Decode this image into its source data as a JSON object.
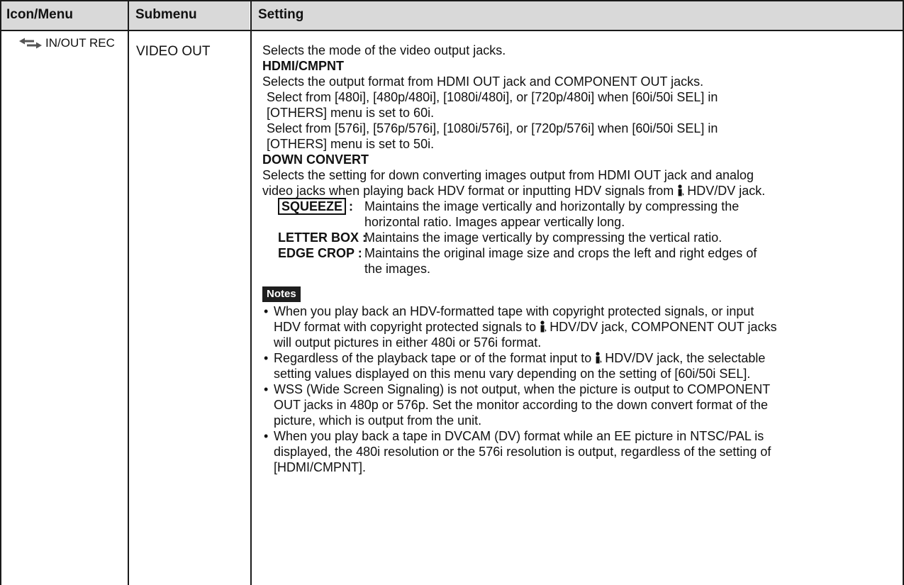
{
  "header": {
    "col1": "Icon/Menu",
    "col2": "Submenu",
    "col3": "Setting"
  },
  "row": {
    "menu": "IN/OUT REC",
    "submenu": "VIDEO OUT",
    "menu_icon": "in-out-arrows-icon"
  },
  "setting": {
    "intro": "Selects the mode of the video output jacks.",
    "hdmi_heading": "HDMI/CMPNT",
    "hdmi_desc": "Selects the output format from HDMI OUT jack and COMPONENT OUT jacks.",
    "select60_a": "Select from [480i], [480p/480i], [1080i/480i], or [720p/480i] when [60i/50i SEL] in",
    "select60_b": "[OTHERS] menu is set to 60i.",
    "select50_a": "Select from [576i], [576p/576i], [1080i/576i], or [720p/576i] when [60i/50i SEL] in",
    "select50_b": "[OTHERS] menu is set to 50i.",
    "down_heading": "DOWN CONVERT",
    "down_desc_a": "Selects the setting for down converting images output from HDMI OUT jack and analog",
    "down_desc_b_pre": "video jacks when playing back HDV format or inputting HDV signals from",
    "down_desc_b_post": "HDV/DV jack.",
    "options": [
      {
        "term": "SQUEEZE",
        "sep": ":",
        "desc": "Maintains the image vertically and horizontally by compressing the horizontal ratio. Images appear vertically long."
      },
      {
        "term": "LETTER BOX :",
        "desc": "Maintains the image vertically by compressing the vertical ratio."
      },
      {
        "term": "EDGE CROP :",
        "desc": "Maintains the original image size and crops the left and right edges of the images."
      }
    ],
    "notes_label": "Notes",
    "notes": {
      "n1_a": "When you play back an HDV-formatted tape with copyright protected signals, or input",
      "n1_b_pre": "HDV format with copyright protected signals to",
      "n1_b_post": "HDV/DV jack, COMPONENT OUT jacks",
      "n1_c": "will output pictures in either 480i or 576i format.",
      "n2_a_pre": "Regardless of the playback tape or of the format input to",
      "n2_a_post": "HDV/DV jack, the selectable",
      "n2_b": "setting values displayed on this menu vary depending on the setting of [60i/50i SEL].",
      "n3_a": "WSS (Wide Screen Signaling) is not output, when the picture is output to COMPONENT",
      "n3_b": "OUT jacks in 480p or 576p. Set the monitor according to the down convert format of the",
      "n3_c": "picture, which is output from the unit.",
      "n4_a": "When you play back a tape in DVCAM (DV) format while an EE picture in NTSC/PAL is",
      "n4_b": "displayed, the 480i resolution or the 576i resolution is output, regardless of the setting of",
      "n4_c": "[HDMI/CMPNT]."
    }
  }
}
